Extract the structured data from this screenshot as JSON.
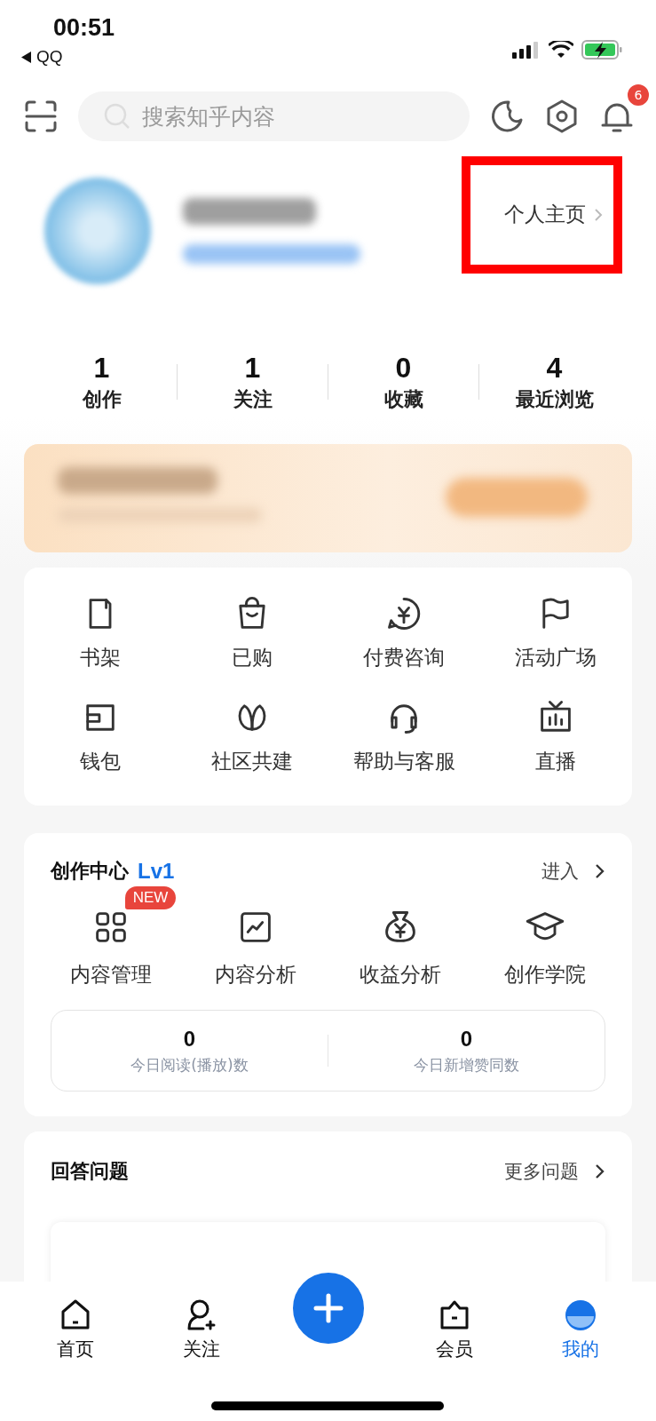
{
  "status_bar": {
    "time": "00:51",
    "back_label": "QQ"
  },
  "search": {
    "placeholder": "搜索知乎内容"
  },
  "notifications": {
    "badge": "6"
  },
  "profile": {
    "homepage_link": "个人主页",
    "highlighted": true
  },
  "stats": [
    {
      "value": "1",
      "label": "创作"
    },
    {
      "value": "1",
      "label": "关注"
    },
    {
      "value": "0",
      "label": "收藏"
    },
    {
      "value": "4",
      "label": "最近浏览"
    }
  ],
  "tools": [
    {
      "label": "书架",
      "kind": "book"
    },
    {
      "label": "已购",
      "kind": "bag"
    },
    {
      "label": "付费咨询",
      "kind": "consult"
    },
    {
      "label": "活动广场",
      "kind": "flag"
    },
    {
      "label": "钱包",
      "kind": "wallet"
    },
    {
      "label": "社区共建",
      "kind": "leaf"
    },
    {
      "label": "帮助与客服",
      "kind": "headset"
    },
    {
      "label": "直播",
      "kind": "tv"
    }
  ],
  "creation_center": {
    "title": "创作中心",
    "level": "Lv1",
    "enter": "进入",
    "tools": [
      {
        "label": "内容管理",
        "kind": "grid",
        "badge": "NEW"
      },
      {
        "label": "内容分析",
        "kind": "chart"
      },
      {
        "label": "收益分析",
        "kind": "moneybag"
      },
      {
        "label": "创作学院",
        "kind": "cap"
      }
    ],
    "today": [
      {
        "value": "0",
        "label": "今日阅读(播放)数"
      },
      {
        "value": "0",
        "label": "今日新增赞同数"
      }
    ]
  },
  "answer": {
    "title": "回答问题",
    "more": "更多问题"
  },
  "tab_bar": [
    {
      "label": "首页",
      "kind": "home",
      "selected": false
    },
    {
      "label": "关注",
      "kind": "follow",
      "selected": false
    },
    {
      "kind": "add"
    },
    {
      "label": "会员",
      "kind": "vip",
      "selected": false
    },
    {
      "label": "我的",
      "kind": "me",
      "selected": true
    }
  ]
}
